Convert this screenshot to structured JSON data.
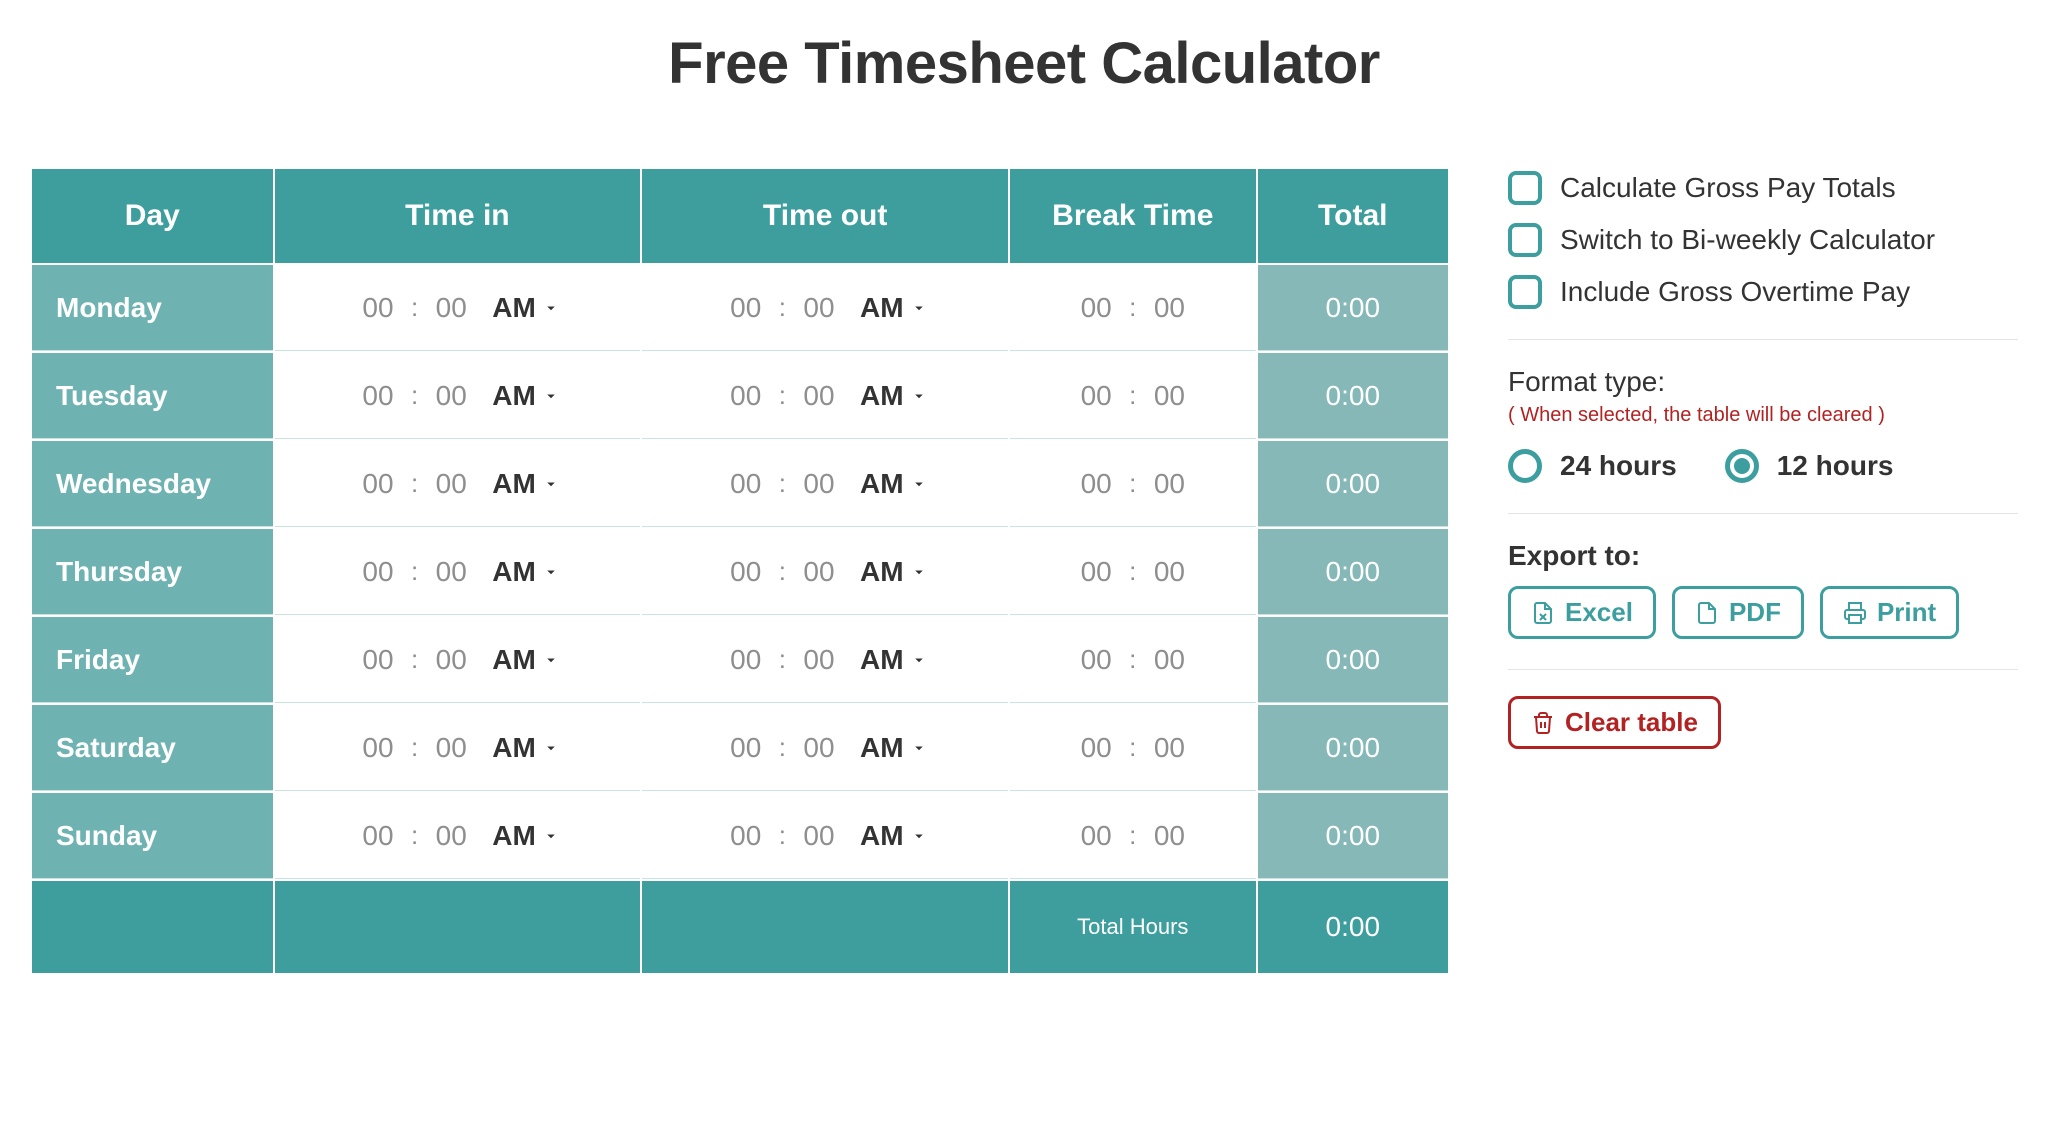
{
  "title": "Free Timesheet Calculator",
  "headers": {
    "day": "Day",
    "time_in": "Time in",
    "time_out": "Time out",
    "break": "Break Time",
    "total": "Total"
  },
  "rows": [
    {
      "day": "Monday",
      "in_hh": "00",
      "in_mm": "00",
      "in_ampm": "AM",
      "out_hh": "00",
      "out_mm": "00",
      "out_ampm": "AM",
      "br_hh": "00",
      "br_mm": "00",
      "total": "0:00"
    },
    {
      "day": "Tuesday",
      "in_hh": "00",
      "in_mm": "00",
      "in_ampm": "AM",
      "out_hh": "00",
      "out_mm": "00",
      "out_ampm": "AM",
      "br_hh": "00",
      "br_mm": "00",
      "total": "0:00"
    },
    {
      "day": "Wednesday",
      "in_hh": "00",
      "in_mm": "00",
      "in_ampm": "AM",
      "out_hh": "00",
      "out_mm": "00",
      "out_ampm": "AM",
      "br_hh": "00",
      "br_mm": "00",
      "total": "0:00"
    },
    {
      "day": "Thursday",
      "in_hh": "00",
      "in_mm": "00",
      "in_ampm": "AM",
      "out_hh": "00",
      "out_mm": "00",
      "out_ampm": "AM",
      "br_hh": "00",
      "br_mm": "00",
      "total": "0:00"
    },
    {
      "day": "Friday",
      "in_hh": "00",
      "in_mm": "00",
      "in_ampm": "AM",
      "out_hh": "00",
      "out_mm": "00",
      "out_ampm": "AM",
      "br_hh": "00",
      "br_mm": "00",
      "total": "0:00"
    },
    {
      "day": "Saturday",
      "in_hh": "00",
      "in_mm": "00",
      "in_ampm": "AM",
      "out_hh": "00",
      "out_mm": "00",
      "out_ampm": "AM",
      "br_hh": "00",
      "br_mm": "00",
      "total": "0:00"
    },
    {
      "day": "Sunday",
      "in_hh": "00",
      "in_mm": "00",
      "in_ampm": "AM",
      "out_hh": "00",
      "out_mm": "00",
      "out_ampm": "AM",
      "br_hh": "00",
      "br_mm": "00",
      "total": "0:00"
    }
  ],
  "footer": {
    "total_hours_label": "Total Hours",
    "total_hours_value": "0:00"
  },
  "options": {
    "gross_pay": "Calculate Gross Pay Totals",
    "biweekly": "Switch to Bi-weekly Calculator",
    "overtime": "Include Gross Overtime Pay"
  },
  "format": {
    "title": "Format type:",
    "note": "( When selected, the table will be cleared )",
    "opt24": "24 hours",
    "opt12": "12 hours",
    "selected": "12"
  },
  "export": {
    "title": "Export to:",
    "excel": "Excel",
    "pdf": "PDF",
    "print": "Print"
  },
  "clear": "Clear table"
}
